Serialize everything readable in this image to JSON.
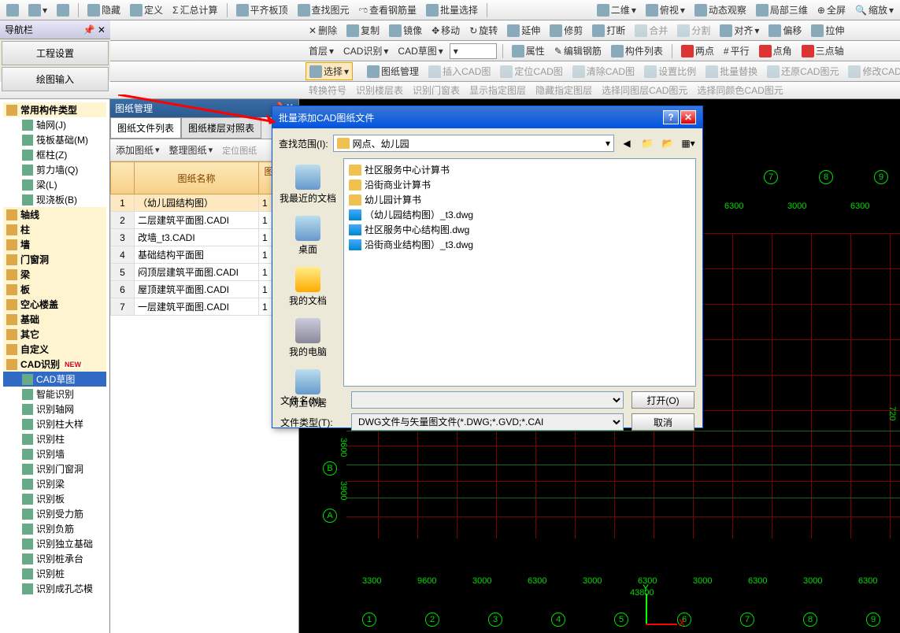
{
  "toolbar1": {
    "hide": "隐藏",
    "define": "定义",
    "sum": "汇总计算",
    "flatten": "平齐板顶",
    "findelem": "查找图元",
    "viewrebar": "查看钢筋量",
    "batchsel": "批量选择",
    "view2d": "二维",
    "top": "俯视",
    "dynview": "动态观察",
    "local3d": "局部三维",
    "fullscreen": "全屏",
    "zoom": "缩放"
  },
  "toolbar2": {
    "delete": "删除",
    "copy": "复制",
    "mirror": "镜像",
    "move": "移动",
    "rotate": "旋转",
    "extend": "延伸",
    "trim": "修剪",
    "break": "打断",
    "merge": "合并",
    "split": "分割",
    "align": "对齐",
    "offset": "偏移",
    "stretch": "拉伸"
  },
  "toolbar3": {
    "floor": "首层",
    "cadrec": "CAD识别",
    "caddraft": "CAD草图",
    "props": "属性",
    "editrebar": "编辑钢筋",
    "complist": "构件列表",
    "twopoint": "两点",
    "parallel": "平行",
    "pointangle": "点角",
    "threepoint": "三点轴"
  },
  "toolbar4": {
    "select": "选择",
    "dwgmgr": "图纸管理",
    "insertcad": "插入CAD图",
    "loccad": "定位CAD图",
    "clearcad": "清除CAD图",
    "setscale": "设置比例",
    "batchrepl": "批量替换",
    "restorecad": "还原CAD图元",
    "modifycad": "修改CAD标",
    "convsym": "转换符号",
    "reclist": "识别楼层表",
    "recdoor": "识别门窗表",
    "showlayer": "显示指定图层",
    "hidelayer": "隐藏指定图层",
    "selsamelayer": "选择同图层CAD图元",
    "selsamecolor": "选择同颜色CAD图元"
  },
  "nav": {
    "title": "导航栏",
    "tab1": "工程设置",
    "tab2": "绘图输入",
    "items": [
      {
        "label": "常用构件类型",
        "l": 1
      },
      {
        "label": "轴网(J)",
        "l": 2
      },
      {
        "label": "筏板基础(M)",
        "l": 2
      },
      {
        "label": "框柱(Z)",
        "l": 2
      },
      {
        "label": "剪力墙(Q)",
        "l": 2
      },
      {
        "label": "梁(L)",
        "l": 2
      },
      {
        "label": "现浇板(B)",
        "l": 2
      },
      {
        "label": "轴线",
        "l": 1
      },
      {
        "label": "柱",
        "l": 1
      },
      {
        "label": "墙",
        "l": 1
      },
      {
        "label": "门窗洞",
        "l": 1
      },
      {
        "label": "梁",
        "l": 1
      },
      {
        "label": "板",
        "l": 1
      },
      {
        "label": "空心楼盖",
        "l": 1
      },
      {
        "label": "基础",
        "l": 1
      },
      {
        "label": "其它",
        "l": 1
      },
      {
        "label": "自定义",
        "l": 1
      },
      {
        "label": "CAD识别",
        "l": 1,
        "new": true
      },
      {
        "label": "CAD草图",
        "l": 2,
        "sel": true
      },
      {
        "label": "智能识别",
        "l": 2
      },
      {
        "label": "识别轴网",
        "l": 2
      },
      {
        "label": "识别柱大样",
        "l": 2
      },
      {
        "label": "识别柱",
        "l": 2
      },
      {
        "label": "识别墙",
        "l": 2
      },
      {
        "label": "识别门窗洞",
        "l": 2
      },
      {
        "label": "识别梁",
        "l": 2
      },
      {
        "label": "识别板",
        "l": 2
      },
      {
        "label": "识别受力筋",
        "l": 2
      },
      {
        "label": "识别负筋",
        "l": 2
      },
      {
        "label": "识别独立基础",
        "l": 2
      },
      {
        "label": "识别桩承台",
        "l": 2
      },
      {
        "label": "识别桩",
        "l": 2
      },
      {
        "label": "识别成孔芯模",
        "l": 2
      }
    ]
  },
  "dwgpanel": {
    "title": "图纸管理",
    "tab1": "图纸文件列表",
    "tab2": "图纸楼层对照表",
    "add": "添加图纸",
    "sort": "整理图纸",
    "locate": "定位图纸",
    "col1": "图纸名称",
    "col2": "图纸比例",
    "rows": [
      {
        "n": "1",
        "name": "（幼儿园结构图）",
        "r": "1",
        "sel": true
      },
      {
        "n": "2",
        "name": "二层建筑平面图.CADI",
        "r": "1"
      },
      {
        "n": "3",
        "name": "改墙_t3.CADI",
        "r": "1"
      },
      {
        "n": "4",
        "name": "基础结构平面图",
        "r": "1"
      },
      {
        "n": "5",
        "name": "闷顶层建筑平面图.CADI",
        "r": "1"
      },
      {
        "n": "6",
        "name": "屋顶建筑平面图.CADI",
        "r": "1"
      },
      {
        "n": "7",
        "name": "一层建筑平面图.CADI",
        "r": "1"
      }
    ]
  },
  "dialog": {
    "title": "批量添加CAD图纸文件",
    "lookin": "查找范围(I):",
    "folder": "网点、幼儿园",
    "places": {
      "recent": "我最近的文档",
      "desktop": "桌面",
      "mydocs": "我的文档",
      "mycomp": "我的电脑",
      "network": "网上邻居"
    },
    "files": [
      {
        "name": "社区服务中心计算书",
        "t": "folder"
      },
      {
        "name": "沿街商业计算书",
        "t": "folder"
      },
      {
        "name": "幼儿园计算书",
        "t": "folder"
      },
      {
        "name": "（幼儿园结构图）_t3.dwg",
        "t": "dwg"
      },
      {
        "name": "社区服务中心结构图.dwg",
        "t": "dwg"
      },
      {
        "name": "沿街商业结构图）_t3.dwg",
        "t": "dwg"
      }
    ],
    "filenamelbl": "文件名(N):",
    "filetypelbl": "文件类型(T):",
    "filetype": "DWG文件与矢量图文件(*.DWG;*.GVD;*.CAI",
    "open": "打开(O)",
    "cancel": "取消"
  },
  "cad": {
    "dims_top": [
      "6300",
      "3000",
      "6300"
    ],
    "dims_bot": [
      "3300",
      "9600",
      "3000",
      "6300",
      "3000",
      "6300",
      "3000",
      "6300",
      "3000",
      "6300"
    ],
    "total": "43800",
    "dims_side": [
      "3600",
      "3900"
    ],
    "side2": [
      "720"
    ],
    "axis_top": [
      "7",
      "8",
      "9"
    ],
    "axis_bot": [
      "1",
      "2",
      "3",
      "4",
      "5",
      "6",
      "7",
      "8",
      "9"
    ],
    "axis_left": [
      "B",
      "A"
    ]
  }
}
